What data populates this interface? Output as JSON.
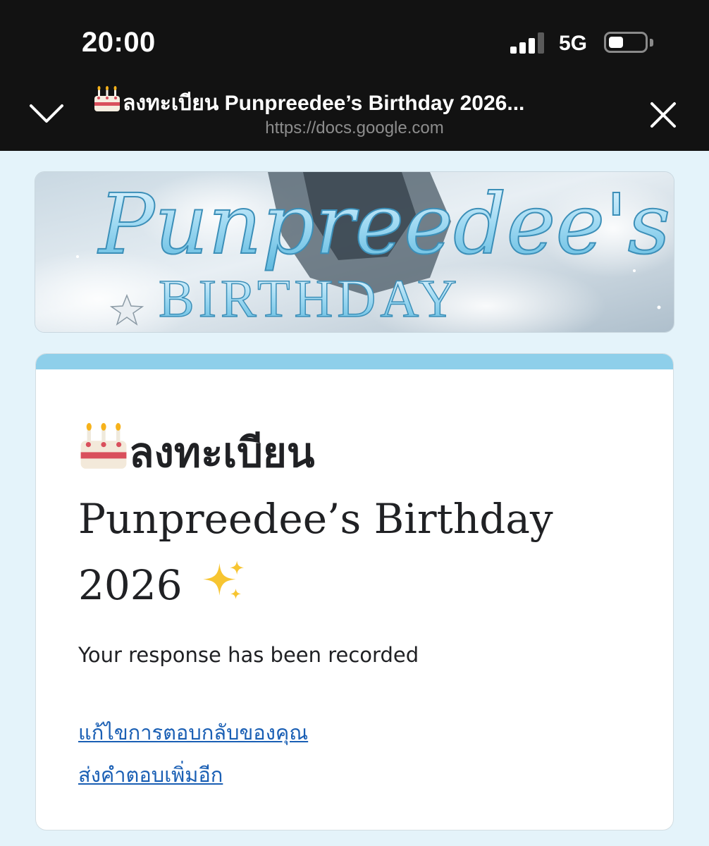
{
  "status_bar": {
    "time": "20:00",
    "network": "5G",
    "signal_bars_active": 3,
    "signal_bars_total": 4,
    "battery_level": 0.35
  },
  "browser": {
    "title": "ลงทะเบียน Punpreedee’s Birthday 2026...",
    "url": "https://docs.google.com",
    "collapse_icon": "chevron-down-icon",
    "close_icon": "close-icon"
  },
  "banner": {
    "script_text": "Punpreedee's",
    "caps_text": "BIRTHDAY"
  },
  "form": {
    "title_thai": "ลงทะเบียน",
    "title_rest": "Punpreedee’s Birthday 2026",
    "title_icon": "cake-icon",
    "title_trailing_icon": "sparkles-icon",
    "confirmation_message": "Your response has been recorded",
    "edit_link": "แก้ไขการตอบกลับของคุณ",
    "submit_another_link": "ส่งคำตอบเพิ่มอีก"
  },
  "colors": {
    "chrome_bg": "#121212",
    "page_bg": "#e4f3fa",
    "card_accent": "#8ecfea",
    "link": "#1a5fb4"
  }
}
